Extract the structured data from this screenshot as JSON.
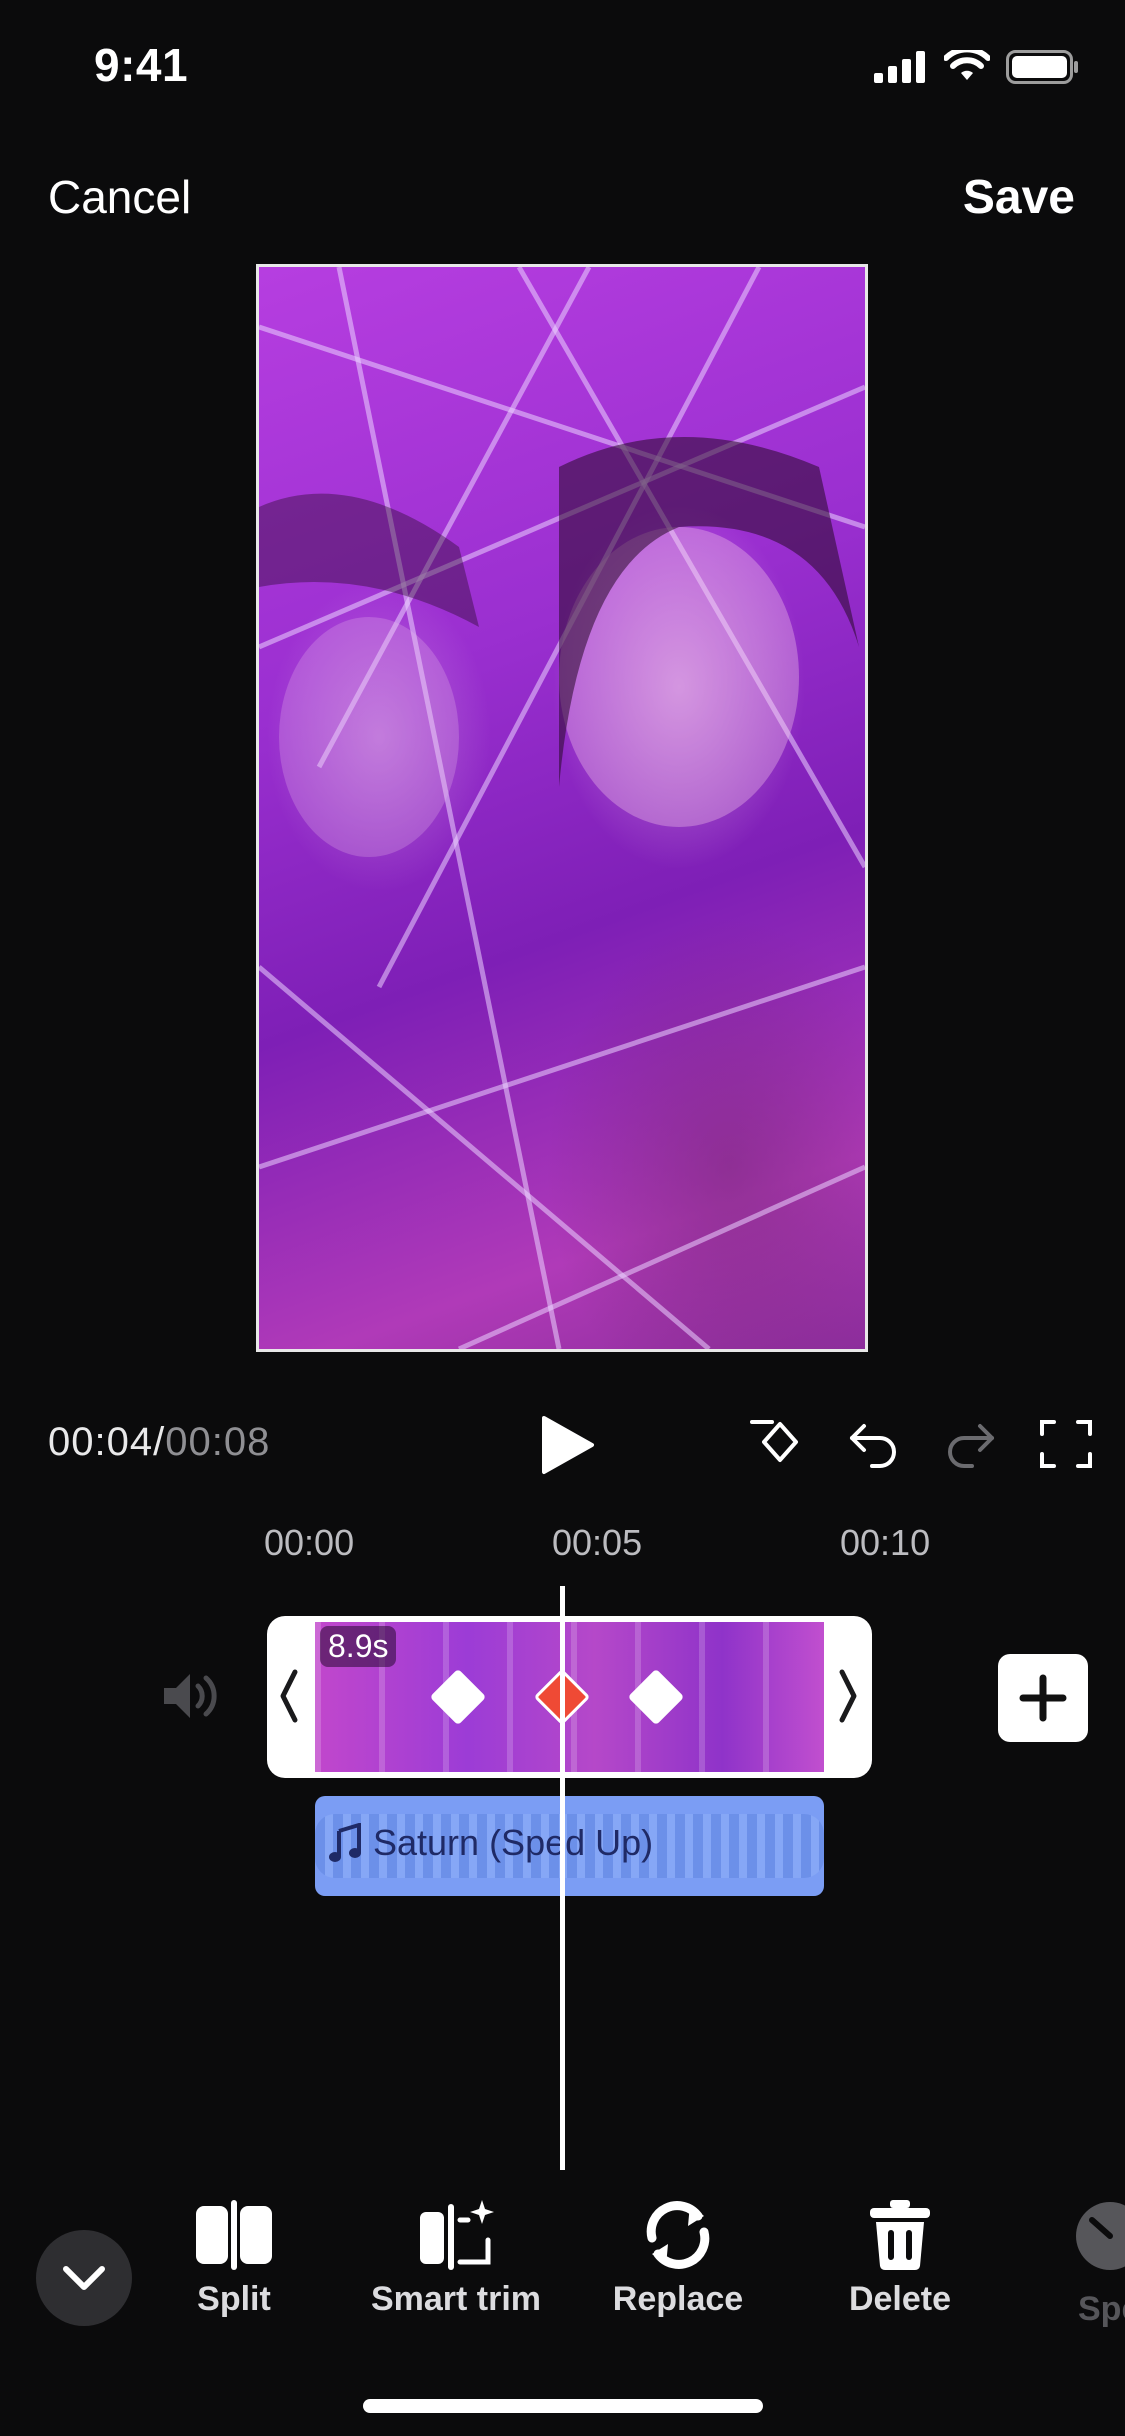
{
  "status_bar": {
    "time": "9:41"
  },
  "header": {
    "cancel_label": "Cancel",
    "save_label": "Save"
  },
  "playback": {
    "current": "00:04",
    "separator": "/",
    "total": "00:08"
  },
  "ruler": {
    "ticks": [
      "00:00",
      "00:05",
      "00:10"
    ]
  },
  "clip": {
    "duration": "8.9s"
  },
  "audio": {
    "title": "Saturn (Sped Up)"
  },
  "toolbar": {
    "items": [
      {
        "label": "Split",
        "icon": "split-icon"
      },
      {
        "label": "Smart trim",
        "icon": "smart-trim-icon"
      },
      {
        "label": "Replace",
        "icon": "replace-icon"
      },
      {
        "label": "Delete",
        "icon": "trash-icon"
      },
      {
        "label": "Spe",
        "icon": "speed-icon"
      }
    ]
  },
  "colors": {
    "background": "#0b0b0c",
    "keyframe_active": "#ef4a35",
    "audio_track": "#7b9df4"
  }
}
